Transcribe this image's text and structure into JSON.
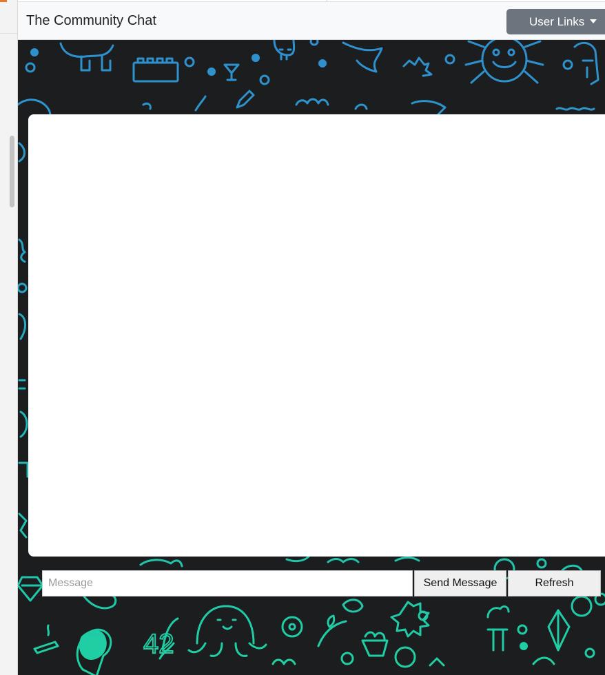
{
  "navbar": {
    "brand": "The Community Chat",
    "user_links_label": "User Links"
  },
  "composer": {
    "placeholder": "Message",
    "value": "",
    "send_label": "Send Message",
    "refresh_label": "Refresh"
  },
  "background": {
    "base_color": "#1c1d1f",
    "top_doodle_color": "#2f8fce",
    "bottom_doodle_color": "#1fd1a1",
    "bottom_doodle_text": "42"
  },
  "colors": {
    "navbar_bg": "#f8f9fa",
    "button_secondary": "#6c757d",
    "panel_bg": "#ffffff"
  }
}
